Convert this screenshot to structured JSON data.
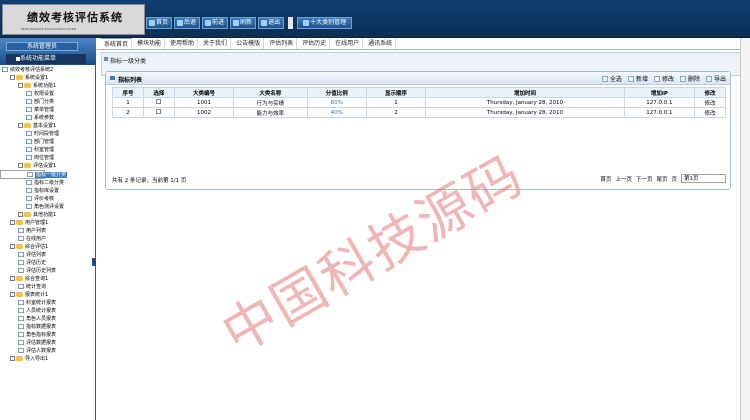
{
  "header": {
    "title": "绩效考核评估系统",
    "subtitle": "PERFORMANCE EVALUATION SYSTEM",
    "nav": [
      "首页",
      "后退",
      "前进",
      "刷新",
      "退出"
    ],
    "wide_btn": "十大类别管理"
  },
  "left": {
    "top_btn": "系统管理员",
    "menu_title": "系统功能菜单",
    "tree": [
      {
        "label": "绩效考核评估系统2",
        "level": 0,
        "type": "root"
      },
      {
        "label": "系统设置1",
        "level": 1,
        "type": "folder"
      },
      {
        "label": "系统功能1",
        "level": 2,
        "type": "folder"
      },
      {
        "label": "权限设置",
        "level": 3,
        "type": "page"
      },
      {
        "label": "部门分类",
        "level": 3,
        "type": "page"
      },
      {
        "label": "菜单管理",
        "level": 3,
        "type": "page"
      },
      {
        "label": "系统参数",
        "level": 3,
        "type": "page"
      },
      {
        "label": "基本设置1",
        "level": 2,
        "type": "folder"
      },
      {
        "label": "时间段管理",
        "level": 3,
        "type": "page"
      },
      {
        "label": "部门管理",
        "level": 3,
        "type": "page"
      },
      {
        "label": "科室管理",
        "level": 3,
        "type": "page"
      },
      {
        "label": "岗位管理",
        "level": 3,
        "type": "page"
      },
      {
        "label": "评估设置1",
        "level": 2,
        "type": "folder"
      },
      {
        "label": "指标一级分类",
        "level": 3,
        "type": "page",
        "selected": true
      },
      {
        "label": "指标二级分类",
        "level": 3,
        "type": "page"
      },
      {
        "label": "指标库设置",
        "level": 3,
        "type": "page"
      },
      {
        "label": "评价考核",
        "level": 3,
        "type": "page"
      },
      {
        "label": "角色测评设置",
        "level": 3,
        "type": "page"
      },
      {
        "label": "其他功能1",
        "level": 2,
        "type": "folder"
      },
      {
        "label": "用户管理1",
        "level": 1,
        "type": "folder"
      },
      {
        "label": "用户列表",
        "level": 2,
        "type": "page"
      },
      {
        "label": "在线用户",
        "level": 2,
        "type": "page"
      },
      {
        "label": "综合评估1",
        "level": 1,
        "type": "folder"
      },
      {
        "label": "评估列表",
        "level": 2,
        "type": "page"
      },
      {
        "label": "评估历史",
        "level": 2,
        "type": "page"
      },
      {
        "label": "评估历史列表",
        "level": 2,
        "type": "page"
      },
      {
        "label": "综合查询1",
        "level": 1,
        "type": "folder"
      },
      {
        "label": "统计查询",
        "level": 2,
        "type": "page"
      },
      {
        "label": "报表统计1",
        "level": 1,
        "type": "folder"
      },
      {
        "label": "科室统计报表",
        "level": 2,
        "type": "page"
      },
      {
        "label": "人员统计报表",
        "level": 2,
        "type": "page"
      },
      {
        "label": "角色人员报表",
        "level": 2,
        "type": "page"
      },
      {
        "label": "指标数据报表",
        "level": 2,
        "type": "page"
      },
      {
        "label": "角色指标报表",
        "level": 2,
        "type": "page"
      },
      {
        "label": "评估数据报表",
        "level": 2,
        "type": "page"
      },
      {
        "label": "评估人数报表",
        "level": 2,
        "type": "page"
      },
      {
        "label": "导入导出1",
        "level": 1,
        "type": "folder"
      }
    ]
  },
  "tabs": [
    "系统首页",
    "模块功能",
    "使用帮助",
    "关于我们",
    "公告模版",
    "评估列表",
    "评估历史",
    "在线用户",
    "通讯系统"
  ],
  "breadcrumb": "指标一级分类",
  "panel": {
    "title": "指标列表",
    "actions": [
      "全选",
      "新增",
      "修改",
      "删除",
      "导出"
    ],
    "columns": [
      "序号",
      "选择",
      "大类编号",
      "大类名称",
      "分值比例",
      "显示顺序",
      "增加时间",
      "增加IP",
      "修改"
    ],
    "rows": [
      [
        "1",
        "",
        "1001",
        "行为与实绩",
        "60%",
        "1",
        "Thursday, January 28, 2010",
        "127.0.0.1",
        "修改"
      ],
      [
        "2",
        "",
        "1002",
        "能力与效率",
        "40%",
        "2",
        "Thursday, January 28, 2010",
        "127.0.0.1",
        "修改"
      ]
    ],
    "footer_left": "共有 2 条记录，当前第 1/1 页",
    "footer_right": [
      "首页",
      "上一页",
      "下一页",
      "尾页",
      "页"
    ],
    "page_select": "第1页"
  },
  "watermark": "中国科技源码"
}
